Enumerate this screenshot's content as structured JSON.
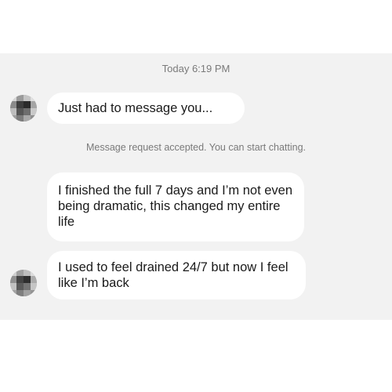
{
  "conversation": {
    "timestamp": "Today 6:19 PM",
    "system_notice": "Message request accepted. You can start chatting.",
    "messages": [
      {
        "sender": "other",
        "text": "Just had to message you..."
      },
      {
        "sender": "other",
        "text": "I finished the full 7 days and I’m not even being dramatic, this changed my entire life"
      },
      {
        "sender": "other",
        "text": "I used to feel drained 24/7 but now I feel like I’m back"
      }
    ]
  },
  "avatar": {
    "icon": "pixelated-profile-avatar-icon"
  }
}
